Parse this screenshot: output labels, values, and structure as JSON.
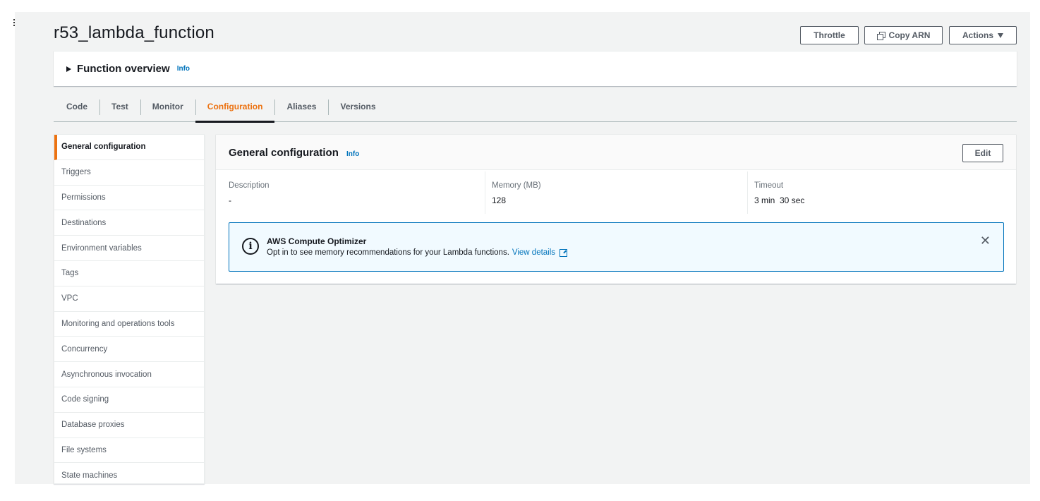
{
  "page": {
    "title": "r53_lambda_function"
  },
  "header_actions": {
    "throttle_label": "Throttle",
    "copy_arn_label": "Copy ARN",
    "actions_label": "Actions"
  },
  "function_overview": {
    "title": "Function overview",
    "info": "Info"
  },
  "tabs": [
    {
      "label": "Code"
    },
    {
      "label": "Test"
    },
    {
      "label": "Monitor"
    },
    {
      "label": "Configuration",
      "active": true
    },
    {
      "label": "Aliases"
    },
    {
      "label": "Versions"
    }
  ],
  "sidebar": {
    "items": [
      {
        "label": "General configuration",
        "active": true
      },
      {
        "label": "Triggers"
      },
      {
        "label": "Permissions"
      },
      {
        "label": "Destinations"
      },
      {
        "label": "Environment variables"
      },
      {
        "label": "Tags"
      },
      {
        "label": "VPC"
      },
      {
        "label": "Monitoring and operations tools"
      },
      {
        "label": "Concurrency"
      },
      {
        "label": "Asynchronous invocation"
      },
      {
        "label": "Code signing"
      },
      {
        "label": "Database proxies"
      },
      {
        "label": "File systems"
      },
      {
        "label": "State machines"
      }
    ]
  },
  "general_config": {
    "title": "General configuration",
    "info": "Info",
    "edit_label": "Edit",
    "fields": [
      {
        "label": "Description",
        "value": "-"
      },
      {
        "label": "Memory (MB)",
        "value": "128"
      },
      {
        "label": "Timeout",
        "value": "3 min  30 sec"
      }
    ]
  },
  "alert": {
    "title": "AWS Compute Optimizer",
    "body": "Opt in to see memory recommendations for your Lambda functions.",
    "link": "View details",
    "close_glyph": "✕"
  },
  "icons": {
    "menu": "menu-icon",
    "copy": "copy-icon",
    "caret": "caret-down-icon",
    "expand": "caret-right-icon",
    "info": "info-circle-icon",
    "external": "external-link-icon",
    "close": "close-icon"
  },
  "colors": {
    "accent": "#ec7211",
    "link": "#0073bb",
    "alert_bg": "#f1faff",
    "page_bg": "#f2f3f3"
  }
}
